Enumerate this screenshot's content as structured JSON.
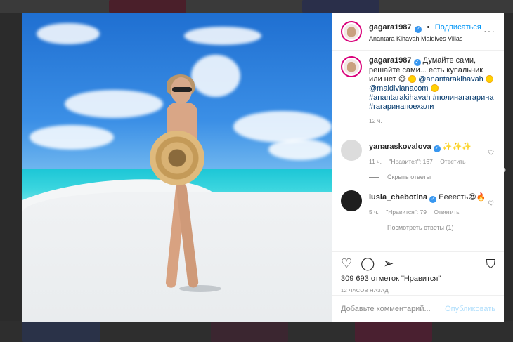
{
  "post": {
    "author": "gagara1987",
    "follow_label": "Подписаться",
    "location": "Anantara Kihavah Maldives Villas",
    "more_icon": "more-horizontal-icon"
  },
  "caption": {
    "author": "gagara1987",
    "text_1": "Думайте сами, решайте сами... есть купальник или нет",
    "mention_1": "@anantarakihavah",
    "mention_2": "@maldivianacom",
    "hashtags": "#anantarakihavah #полинагагарина #гагаринапоехали",
    "time": "12 ч."
  },
  "comments": [
    {
      "author": "yanaraskovalova",
      "emoji": "✨✨✨",
      "time": "11 ч.",
      "likes": "\"Нравится\": 167",
      "reply": "Ответить",
      "thread": "Скрыть ответы"
    },
    {
      "author": "lusia_chebotina",
      "text": "Еееесть",
      "emoji": "😍🔥",
      "time": "5 ч.",
      "likes": "\"Нравится\": 79",
      "reply": "Ответить",
      "thread": "Посмотреть ответы (1)"
    }
  ],
  "stats": {
    "likes": "309 693 отметок \"Нравится\"",
    "time": "12 ЧАСОВ НАЗАД"
  },
  "composer": {
    "placeholder": "Добавьте комментарий...",
    "publish_label": "Опубликовать"
  },
  "colors": {
    "accent": "#0095f6",
    "verified": "#3897f0"
  }
}
